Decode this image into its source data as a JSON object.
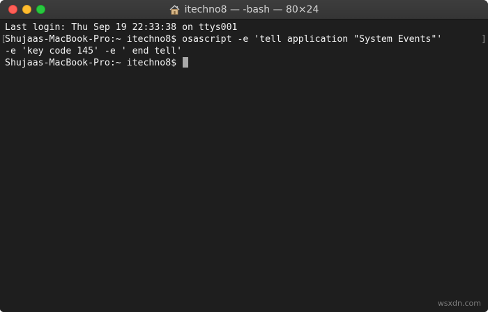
{
  "window": {
    "title": "itechno8 — -bash — 80×24",
    "title_icon": "home-folder-icon",
    "controls": {
      "close_color": "#fe5f57",
      "minimize_color": "#febc2e",
      "zoom_color": "#28c840"
    }
  },
  "terminal": {
    "lines": [
      "Last login: Thu Sep 19 22:33:38 on ttys001",
      "Shujaas-MacBook-Pro:~ itechno8$ osascript -e 'tell application \"System Events\"'",
      "-e 'key code 145' -e ' end tell'",
      "Shujaas-MacBook-Pro:~ itechno8$ "
    ],
    "wrap_bracket_left": "[",
    "wrap_bracket_right": "]",
    "background": "#1e1e1e",
    "foreground": "#f2f2f2"
  },
  "watermark": "wsxdn.com"
}
